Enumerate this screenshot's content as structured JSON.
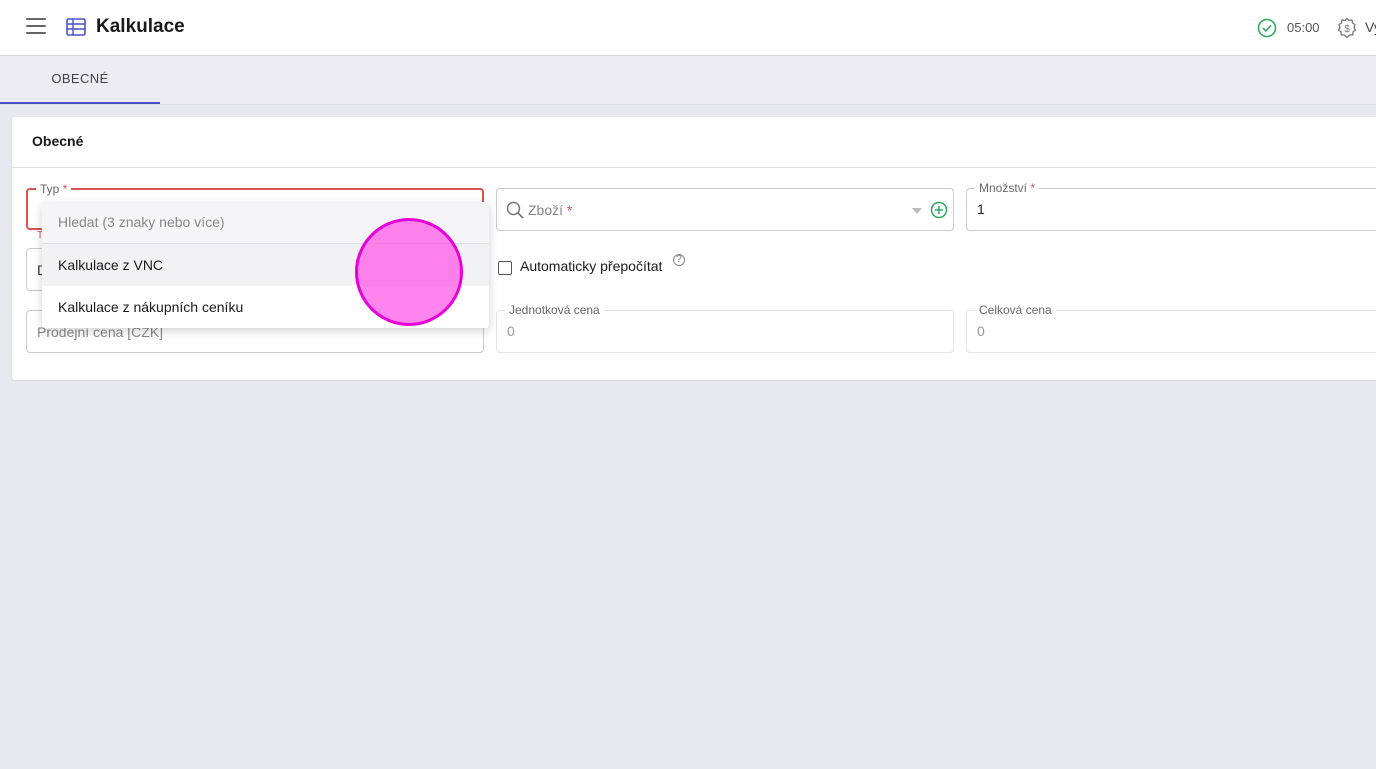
{
  "header": {
    "title": "Kalkulace",
    "time": "05:00",
    "user_text": "Vy",
    "status_color": "#2eaa5c"
  },
  "tabs": [
    {
      "label": "OBECNÉ",
      "active": true
    }
  ],
  "section": {
    "title": "Obecné"
  },
  "fields": {
    "typ": {
      "label": "Typ",
      "required_mark": "*",
      "error_hint": "T"
    },
    "second_row_left_partial": "D",
    "zbozi": {
      "placeholder": "Zboží",
      "required_mark": "*"
    },
    "mnozstvi": {
      "label": "Množství",
      "required_mark": "*",
      "value": "1"
    },
    "auto_recalc": {
      "label": "Automaticky přepočítat",
      "checked": false
    },
    "prodejni_cena": {
      "placeholder": "Prodejní cena [CZK]"
    },
    "jednotkova_cena": {
      "label": "Jednotková cena",
      "value": "0"
    },
    "celkova_cena": {
      "label": "Celková cena",
      "value": "0"
    }
  },
  "dropdown": {
    "search_placeholder": "Hledat (3 znaky nebo více)",
    "options": [
      "Kalkulace z VNC",
      "Kalkulace z nákupních ceníku"
    ]
  },
  "icons": {
    "menu": "menu-icon",
    "table": "table-icon",
    "status": "check-circle-icon",
    "currency": "dollar-gear-icon",
    "search": "search-icon",
    "add": "plus-circle-icon",
    "caret": "caret-down-icon",
    "help": "help-icon"
  },
  "colors": {
    "accent": "#4a52c8",
    "error": "#d9534f",
    "add_green": "#2eaa5c",
    "cursor_marker": "#ff50e6"
  }
}
